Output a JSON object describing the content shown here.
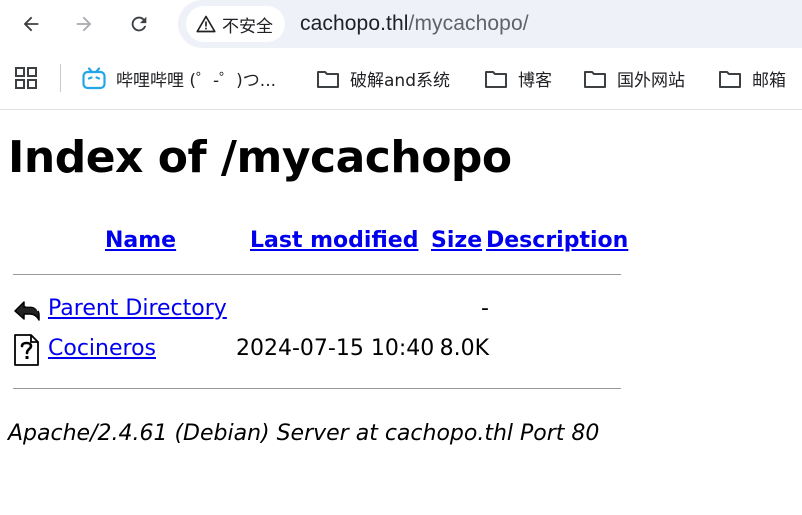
{
  "browser": {
    "security_label": "不安全",
    "url_host": "cachopo.thl",
    "url_path": "/mycachopo/",
    "bookmarks": [
      {
        "label": "哔哩哔哩 (゜-゜)つ..."
      },
      {
        "label": "破解and系统"
      },
      {
        "label": "博客"
      },
      {
        "label": "国外网站"
      },
      {
        "label": "邮箱"
      }
    ]
  },
  "page": {
    "title": "Index of /mycachopo",
    "columns": {
      "name": "Name",
      "last_modified": "Last modified",
      "size": "Size",
      "description": "Description"
    },
    "rows": [
      {
        "name": "Parent Directory",
        "date": "",
        "size": "-",
        "icon": "back-arrow-icon"
      },
      {
        "name": "Cocineros",
        "date": "2024-07-15 10:40",
        "size": "8.0K",
        "icon": "unknown-file-icon"
      }
    ],
    "footer": "Apache/2.4.61 (Debian) Server at cachopo.thl Port 80"
  },
  "colors": {
    "link": "#0000ee",
    "omnibox_bg": "#eef1f8"
  }
}
